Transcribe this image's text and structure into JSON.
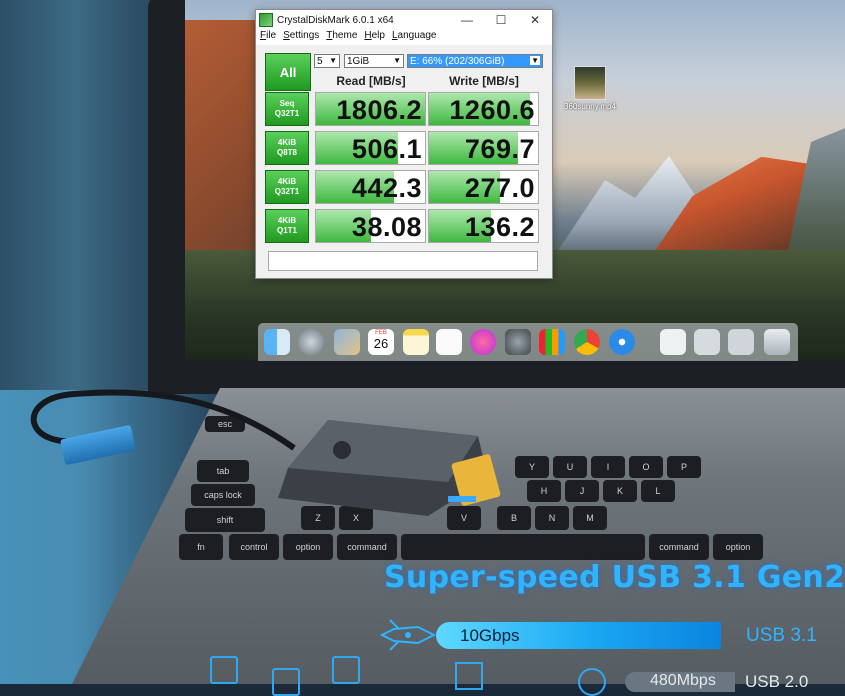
{
  "cdm": {
    "title": "CrystalDiskMark 6.0.1 x64",
    "window_controls": {
      "minimize": "—",
      "maximize": "☐",
      "close": "✕"
    },
    "menu": [
      "File",
      "Settings",
      "Theme",
      "Help",
      "Language"
    ],
    "all_button": "All",
    "count_select": "5",
    "size_select": "1GiB",
    "drive_select": "E: 66% (202/306GiB)",
    "read_header": "Read [MB/s]",
    "write_header": "Write [MB/s]",
    "rows": [
      {
        "line1": "Seq",
        "line2": "Q32T1",
        "read": "1806.2",
        "write": "1260.6",
        "read_fill": 1.0,
        "write_fill": 0.93
      },
      {
        "line1": "4KiB",
        "line2": "Q8T8",
        "read": "506.1",
        "write": "769.7",
        "read_fill": 0.75,
        "write_fill": 0.82
      },
      {
        "line1": "4KiB",
        "line2": "Q32T1",
        "read": "442.3",
        "write": "277.0",
        "read_fill": 0.72,
        "write_fill": 0.65
      },
      {
        "line1": "4KiB",
        "line2": "Q1T1",
        "read": "38.08",
        "write": "136.2",
        "read_fill": 0.5,
        "write_fill": 0.57
      }
    ]
  },
  "desktop_file": {
    "name": "360sunny.mp4"
  },
  "dock_calendar": {
    "month": "FEB",
    "day": "26"
  },
  "keyboard": {
    "keys": [
      "esc",
      "tab",
      "caps lock",
      "shift",
      "fn",
      "control",
      "option",
      "command",
      "command",
      "option",
      "Y",
      "U",
      "I",
      "O",
      "P",
      "H",
      "J",
      "K",
      "L",
      "V",
      "B",
      "N",
      "M",
      "Z",
      "X"
    ]
  },
  "headline": "Super-speed USB 3.1 Gen2",
  "speed": {
    "label": "10Gbps",
    "standard": "USB 3.1"
  },
  "bottom": {
    "pill": "480Mbps",
    "standard": "USB 2.0"
  },
  "colors": {
    "accent": "#2fb4ff",
    "cdm_green": "#1f9a1f"
  }
}
